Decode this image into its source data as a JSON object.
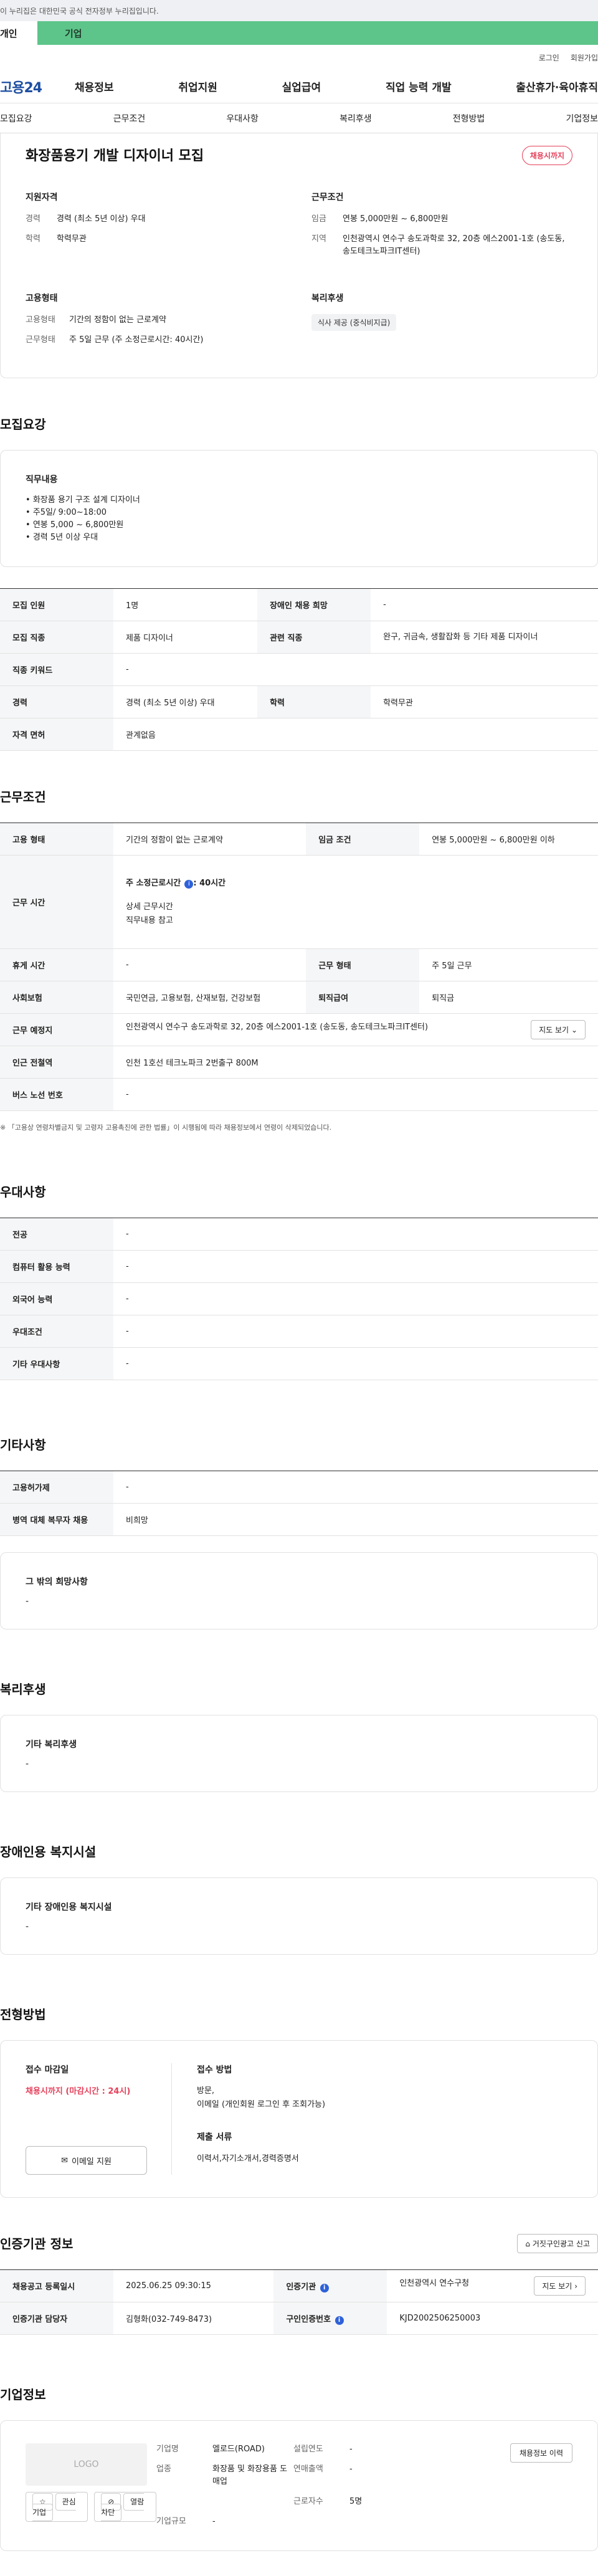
{
  "gov_banner": {
    "text": "이 누리집은 대한민국 공식 전자정부 누리집입니다."
  },
  "site_tabs": [
    "개인",
    "기업"
  ],
  "util_links": [
    "로그인",
    "회원가입"
  ],
  "gnb": {
    "logo": "고용24",
    "menu": [
      "채용정보",
      "취업지원",
      "실업급여",
      "직업 능력 개발",
      "출산휴가·육아휴직"
    ]
  },
  "subnav": [
    "모집요강",
    "근무조건",
    "우대사항",
    "복리후생",
    "전형방법",
    "기업정보"
  ],
  "summary": {
    "title": "화장품용기 개발 디자이너 모집",
    "badge": "채용시까지",
    "qual": {
      "heading": "지원자격",
      "rows": [
        {
          "k": "경력",
          "v": "경력 (최소 5년 이상) 우대"
        },
        {
          "k": "학력",
          "v": "학력무관"
        }
      ]
    },
    "work": {
      "heading": "근무조건",
      "rows": [
        {
          "k": "임금",
          "v": "연봉 5,000만원 ~ 6,800만원"
        },
        {
          "k": "지역",
          "v": "인천광역시 연수구 송도과학로 32, 20층 에스2001-1호 (송도동, 송도테크노파크IT센터)"
        }
      ]
    },
    "employ": {
      "heading": "고용형태",
      "rows": [
        {
          "k": "고용형태",
          "v": "기간의 정함이 없는 근로계약"
        },
        {
          "k": "근무형태",
          "v": "주 5일 근무 (주 소정근로시간: 40시간)"
        }
      ]
    },
    "welfare": {
      "heading": "복리후생",
      "chip": "식사 제공 (중식비지급)"
    }
  },
  "recruit": {
    "title": "모집요강",
    "duty_heading": "직무내용",
    "duties": [
      "화장품 용기 구조 설계 디자이너",
      "주5일/ 9:00~18:00",
      "연봉 5,000 ~ 6,800만원",
      "경력 5년 이상 우대"
    ],
    "table": {
      "r1": [
        "모집 인원",
        "1명",
        "장애인 채용 희망",
        "-"
      ],
      "r2": [
        "모집 직종",
        "제품 디자이너",
        "관련 직종",
        "완구, 귀금속, 생활잡화 등 기타 제품 디자이너"
      ],
      "r3": [
        "직종 키워드",
        "-"
      ],
      "r4": [
        "경력",
        "경력 (최소 5년 이상) 우대",
        "학력",
        "학력무관"
      ],
      "r5": [
        "자격 면허",
        "관계없음"
      ]
    }
  },
  "conditions": {
    "title": "근무조건",
    "r1": [
      "고용 형태",
      "기간의 정함이 없는 근로계약",
      "임금 조건",
      "연봉 5,000만원 ~ 6,800만원 이하"
    ],
    "worktime": {
      "label": "근무 시간",
      "main": "주 소정근로시간",
      "main_val": ": 40시간",
      "detail_label": "상세 근무시간",
      "detail_val": "직무내용 참고"
    },
    "r3": [
      "휴게 시간",
      "-",
      "근무 형태",
      "주 5일 근무"
    ],
    "r4": [
      "사회보험",
      "국민연금, 고용보험, 산재보험, 건강보험",
      "퇴직급여",
      "퇴직금"
    ],
    "r5": [
      "근무 예정지",
      "인천광역시 연수구 송도과학로 32, 20층 에스2001-1호 (송도동, 송도테크노파크IT센터)"
    ],
    "map_btn": "지도 보기",
    "r6": [
      "인근 전철역",
      "인천 1호선 테크노파크 2번출구 800M"
    ],
    "r7": [
      "버스 노선 번호",
      "-"
    ],
    "note": "※ 「고용상 연령차별금지 및 고령자 고용촉진에 관한 법률」이 시행됨에 따라 채용정보에서 연령이 삭제되었습니다."
  },
  "preference": {
    "title": "우대사항",
    "rows": [
      [
        "전공",
        "-"
      ],
      [
        "컴퓨터 활용 능력",
        "-"
      ],
      [
        "외국어 능력",
        "-"
      ],
      [
        "우대조건",
        "-"
      ],
      [
        "기타 우대사항",
        "-"
      ]
    ]
  },
  "etc": {
    "title": "기타사항",
    "rows": [
      [
        "고용허가제",
        "-"
      ],
      [
        "병역 대체 복무자 채용",
        "비희망"
      ]
    ],
    "other_heading": "그 밖의 희망사항",
    "other_val": "-"
  },
  "welfare": {
    "title": "복리후생",
    "heading": "기타 복리후생",
    "val": "-"
  },
  "disabled": {
    "title": "장애인용 복지시설",
    "heading": "기타 장애인용 복지시설",
    "val": "-"
  },
  "apply": {
    "title": "전형방법",
    "deadline_heading": "접수 마감일",
    "deadline": "채용시까지 (마감시간 : 24시)",
    "email_btn": "이메일 지원",
    "method_heading": "접수 방법",
    "method_l1": "방문,",
    "method_l2": "이메일 (개인회원 로그인 후 조회가능)",
    "docs_heading": "제출 서류",
    "docs": "이력서,자기소개서,경력증명서"
  },
  "agency": {
    "title": "인증기관 정보",
    "report_btn": "거짓구인광고 신고",
    "r1": [
      "채용공고 등록일시",
      "2025.06.25 09:30:15",
      "인증기관",
      "인천광역시 연수구청"
    ],
    "map_btn": "지도 보기",
    "r2": [
      "인증기관 담당자",
      "김형화(032-749-8473)",
      "구인인증번호",
      "KJD2002506250003"
    ]
  },
  "company": {
    "title": "기업정보",
    "logo": "LOGO",
    "interest_btn": "관심기업",
    "block_btn": "열람차단",
    "rows": [
      [
        "기업명",
        "엘로드(ROAD)",
        "설립연도",
        "-"
      ],
      [
        "업종",
        "화장품 및 화장용품 도매업",
        "연매출액",
        "-"
      ],
      [
        "",
        "",
        "근로자수",
        "5명"
      ],
      [
        "기업규모",
        "-",
        "",
        ""
      ]
    ],
    "history_btn": "채용정보 이력"
  }
}
